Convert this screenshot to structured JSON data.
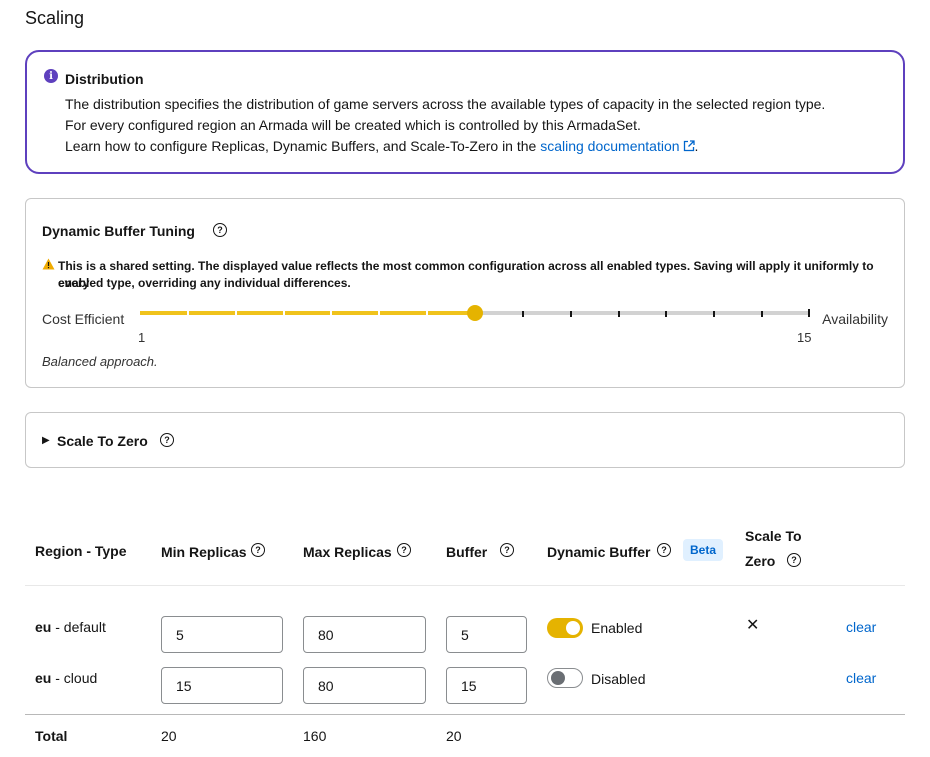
{
  "page": {
    "title": "Scaling"
  },
  "alert": {
    "title": "Distribution",
    "line1": "The distribution specifies the distribution of game servers across the available types of capacity in the selected region type.",
    "line2": "For every configured region an Armada will be created which is controlled by this ArmadaSet.",
    "line3_prefix": "Learn how to configure Replicas, Dynamic Buffers, and Scale-To-Zero in the ",
    "link_text": "scaling documentation",
    "line3_suffix": "."
  },
  "dynamic_buffer": {
    "title": "Dynamic Buffer Tuning",
    "warning_line1": "This is a shared setting. The displayed value reflects the most common configuration across all enabled types. Saving will apply it uniformly to every",
    "warning_line2": "enabled type, overriding any individual differences.",
    "left_label": "Cost Efficient",
    "right_label": "Availability",
    "min": 1,
    "max": 15,
    "min_label": "1",
    "max_label": "15",
    "value": 8,
    "description": "Balanced approach."
  },
  "scale_to_zero": {
    "title": "Scale To Zero"
  },
  "table": {
    "headers": {
      "region_type": "Region - Type",
      "min_replicas": "Min Replicas",
      "max_replicas": "Max Replicas",
      "buffer": "Buffer",
      "dynamic_buffer": "Dynamic Buffer",
      "beta": "Beta",
      "scale_to_zero_1": "Scale To",
      "scale_to_zero_2": "Zero"
    },
    "rows": [
      {
        "region": "eu",
        "sep": " - ",
        "type": "default",
        "min": "5",
        "max": "80",
        "buffer": "5",
        "dynamic_label": "Enabled",
        "dynamic_on": true,
        "scale_to_zero": "✕",
        "action": "clear"
      },
      {
        "region": "eu",
        "sep": " - ",
        "type": "cloud",
        "min": "15",
        "max": "80",
        "buffer": "15",
        "dynamic_label": "Disabled",
        "dynamic_on": false,
        "scale_to_zero": "",
        "action": "clear"
      }
    ],
    "total": {
      "label": "Total",
      "min": "20",
      "max": "160",
      "buffer": "20"
    }
  },
  "colors": {
    "accent_purple": "#5e40be",
    "slider_yellow": "#f0c31c",
    "toggle_on": "#e5b300",
    "link_blue": "#0066cc"
  },
  "icons": {
    "alert": "info-circle-icon",
    "help": "question-circle-icon",
    "warning": "warning-triangle-icon",
    "external": "external-link-icon",
    "caret": "caret-right-icon",
    "close": "times-icon"
  }
}
